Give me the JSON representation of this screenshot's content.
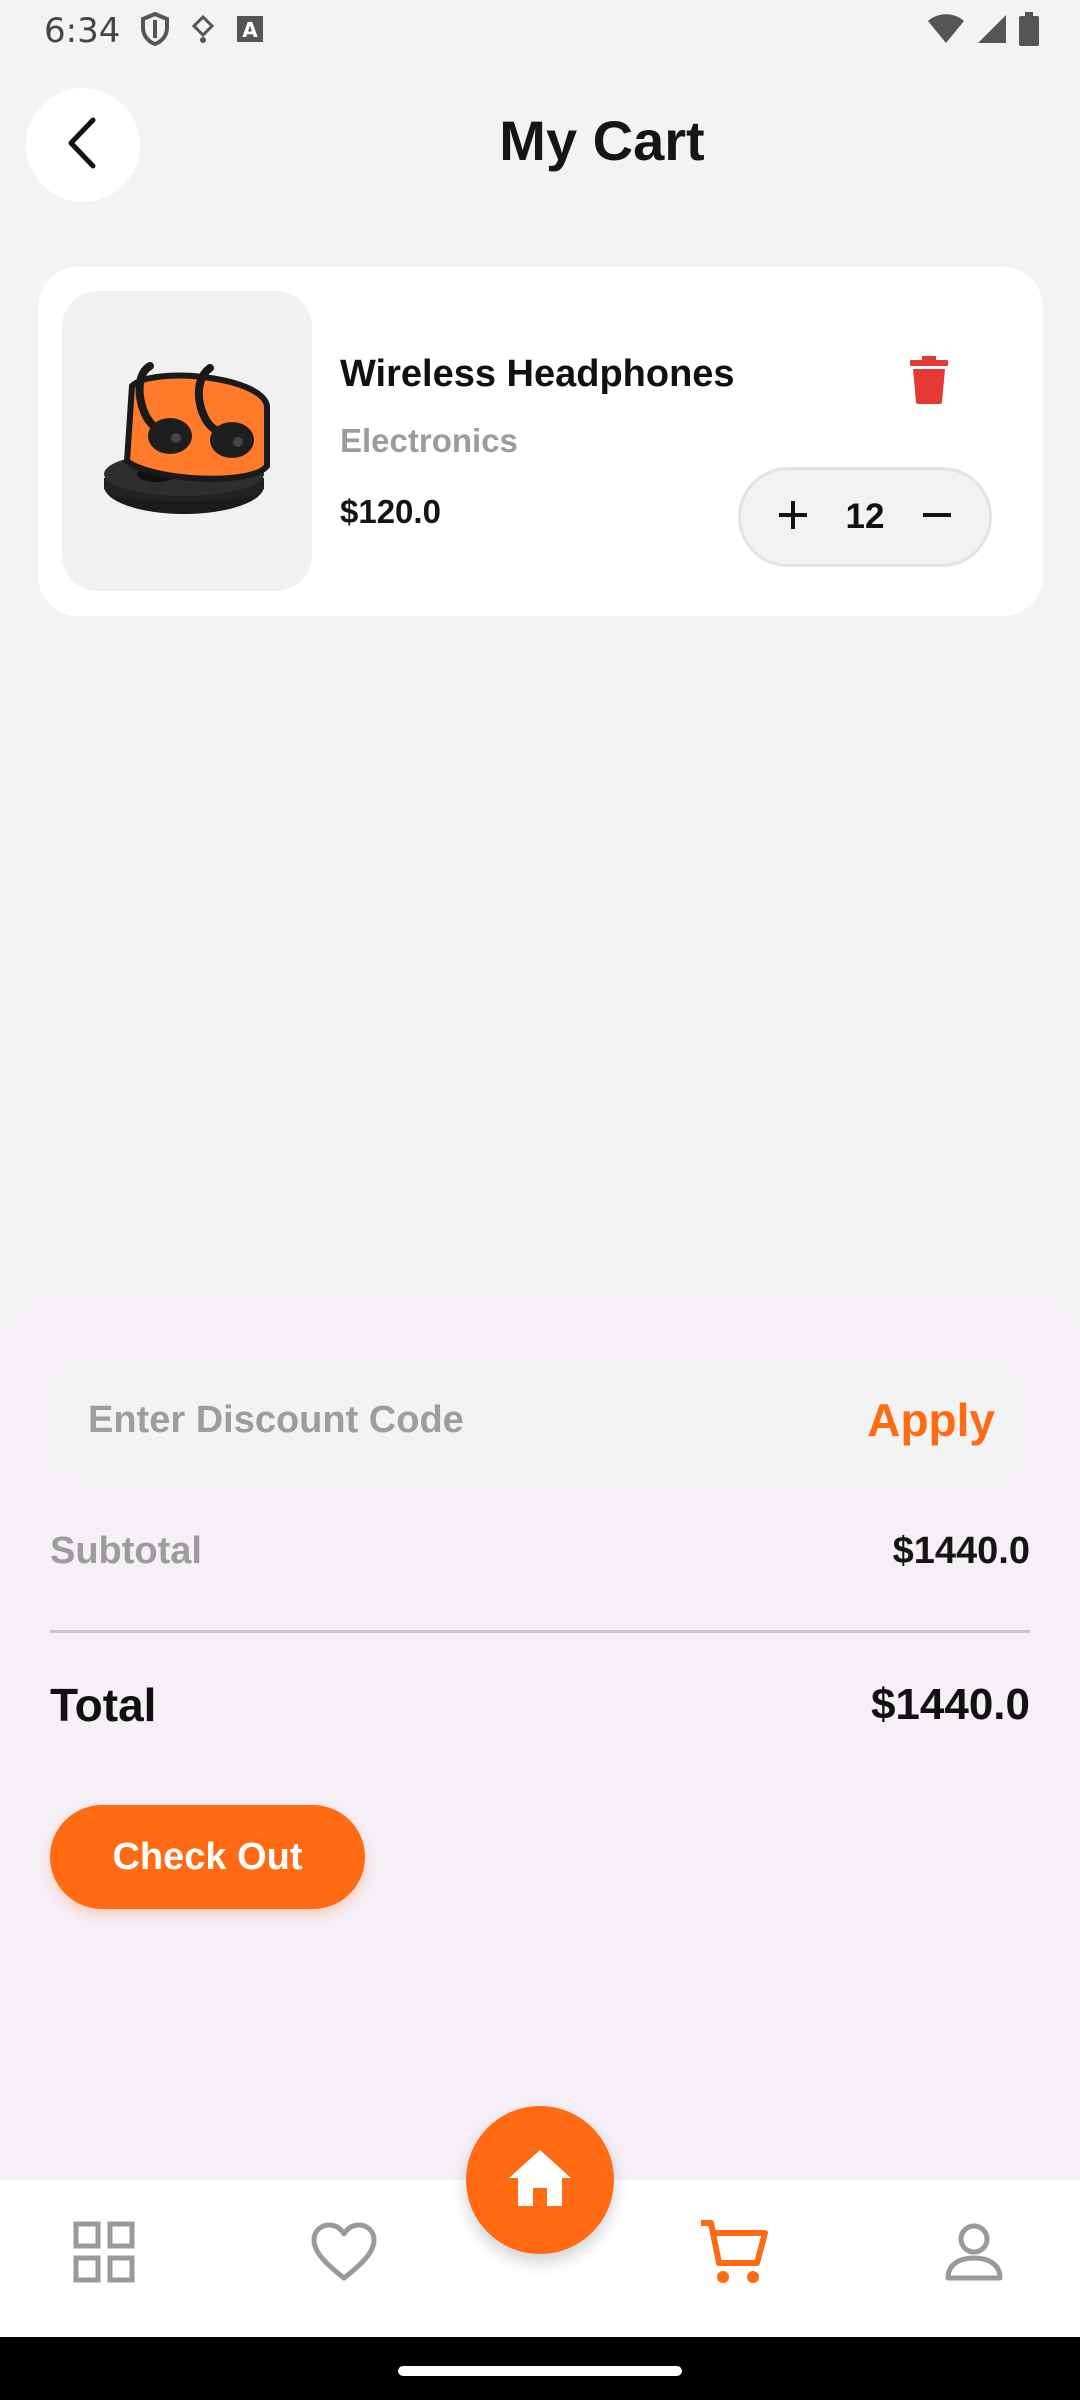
{
  "status_bar": {
    "time": "6:34",
    "icons": [
      "shield-icon",
      "usb-debug-icon",
      "text-a-icon",
      "wifi-icon",
      "signal-icon",
      "battery-icon"
    ]
  },
  "header": {
    "title": "My Cart",
    "back_icon": "chevron-left-icon"
  },
  "cart": {
    "items": [
      {
        "name": "Wireless Headphones",
        "category": "Electronics",
        "price": "$120.0",
        "quantity": "12",
        "image": "earbuds-case-image"
      }
    ]
  },
  "summary": {
    "discount_placeholder": "Enter Discount Code",
    "apply_label": "Apply",
    "subtotal_label": "Subtotal",
    "subtotal_value": "$1440.0",
    "total_label": "Total",
    "total_value": "$1440.0",
    "checkout_label": "Check Out"
  },
  "bottom_nav": {
    "items": [
      "grid-icon",
      "heart-icon",
      "home-icon",
      "cart-icon",
      "profile-icon"
    ],
    "active": "cart-icon"
  },
  "colors": {
    "accent": "#ff6a13",
    "delete": "#e53935",
    "panel": "#f5eff6",
    "background": "#f4f3f4"
  }
}
